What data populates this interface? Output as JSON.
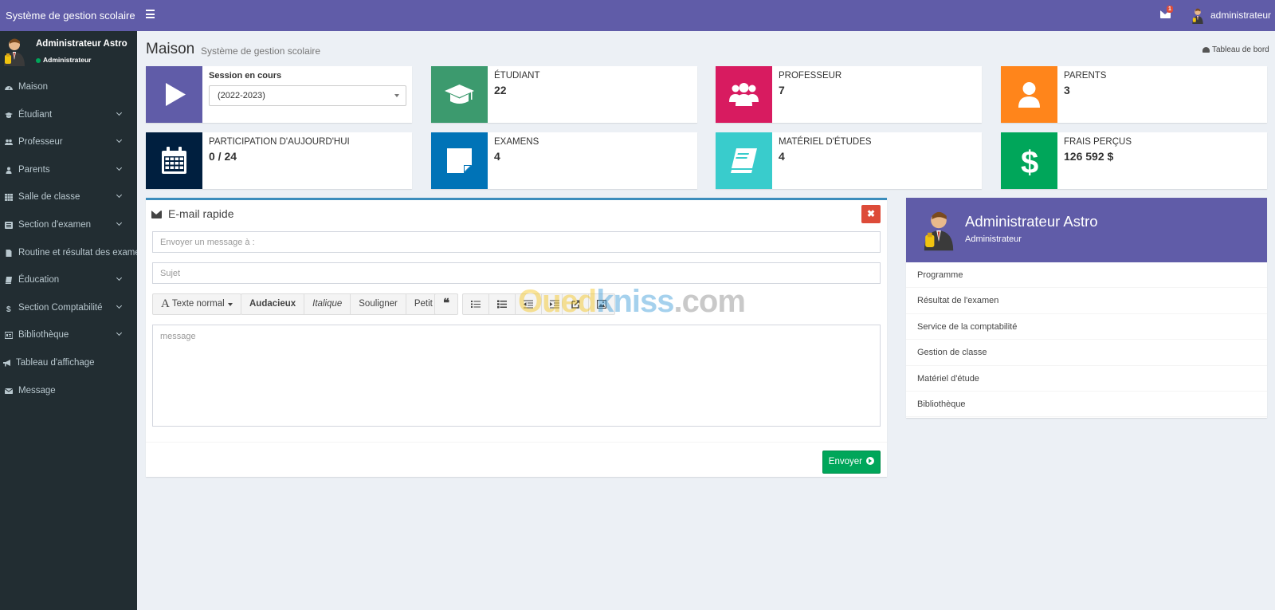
{
  "app": {
    "brand": "Système de gestion scolaire",
    "header_color": "#605ca8",
    "sidebar_color": "#222d32"
  },
  "topbar": {
    "mail_badge": "1",
    "username": "administrateur"
  },
  "sidebar": {
    "user": {
      "name": "Administrateur Astro",
      "role": "Administrateur"
    },
    "items": [
      {
        "label": "Maison",
        "icon": "dashboard-icon",
        "has_submenu": false
      },
      {
        "label": "Étudiant",
        "icon": "graduation-cap-icon",
        "has_submenu": true
      },
      {
        "label": "Professeur",
        "icon": "users-icon",
        "has_submenu": true
      },
      {
        "label": "Parents",
        "icon": "user-icon",
        "has_submenu": true
      },
      {
        "label": "Salle de classe",
        "icon": "grid-icon",
        "has_submenu": true
      },
      {
        "label": "Section d'examen",
        "icon": "list-alt-icon",
        "has_submenu": true
      },
      {
        "label": "Routine et résultat des examens",
        "icon": "file-icon",
        "has_submenu": false
      },
      {
        "label": "Éducation",
        "icon": "book-icon",
        "has_submenu": true
      },
      {
        "label": "Section Comptabilité",
        "icon": "dollar-icon",
        "has_submenu": true
      },
      {
        "label": "Bibliothèque",
        "icon": "library-icon",
        "has_submenu": true
      },
      {
        "label": "Tableau d'affichage",
        "icon": "bullhorn-icon",
        "has_submenu": false
      },
      {
        "label": "Message",
        "icon": "envelope-icon",
        "has_submenu": false
      }
    ]
  },
  "header": {
    "title": "Maison",
    "subtitle": "Système de gestion scolaire",
    "breadcrumb": "Tableau de bord"
  },
  "info_boxes": {
    "session": {
      "label": "Session en cours",
      "selected": "(2022-2023)",
      "color": "#605ca8"
    },
    "students": {
      "label": "ÉTUDIANT",
      "value": "22",
      "color": "#3c9a6e"
    },
    "teachers": {
      "label": "PROFESSEUR",
      "value": "7",
      "color": "#d81b60"
    },
    "parents": {
      "label": "PARENTS",
      "value": "3",
      "color": "#ff851b"
    },
    "attendance": {
      "label": "PARTICIPATION D'AUJOURD'HUI",
      "value": "0 / 24",
      "color": "#001f3f"
    },
    "exams": {
      "label": "EXAMENS",
      "value": "4",
      "color": "#0073b7"
    },
    "materials": {
      "label": "MATÉRIEL D'ÉTUDES",
      "value": "4",
      "color": "#39cccc"
    },
    "fees": {
      "label": "FRAIS PERÇUS",
      "value": "126 592 $",
      "color": "#00a65a"
    }
  },
  "email": {
    "title": "E-mail rapide",
    "close_label": "✖",
    "to_placeholder": "Envoyer un message à :",
    "subject_placeholder": "Sujet",
    "message_placeholder": "message",
    "toolbar": {
      "font_style": "Texte normal",
      "bold": "Audacieux",
      "italic": "Italique",
      "underline": "Souligner",
      "small": "Petit",
      "quote": "❝"
    },
    "send_label": "Envoyer"
  },
  "profile_widget": {
    "name": "Administrateur Astro",
    "role": "Administrateur",
    "links": [
      "Programme",
      "Résultat de l'examen",
      "Service de la comptabilité",
      "Gestion de classe",
      "Matériel d'étude",
      "Bibliothèque"
    ]
  },
  "watermark": {
    "part1": "Oued",
    "part2": "kniss",
    "part3": ".com"
  }
}
